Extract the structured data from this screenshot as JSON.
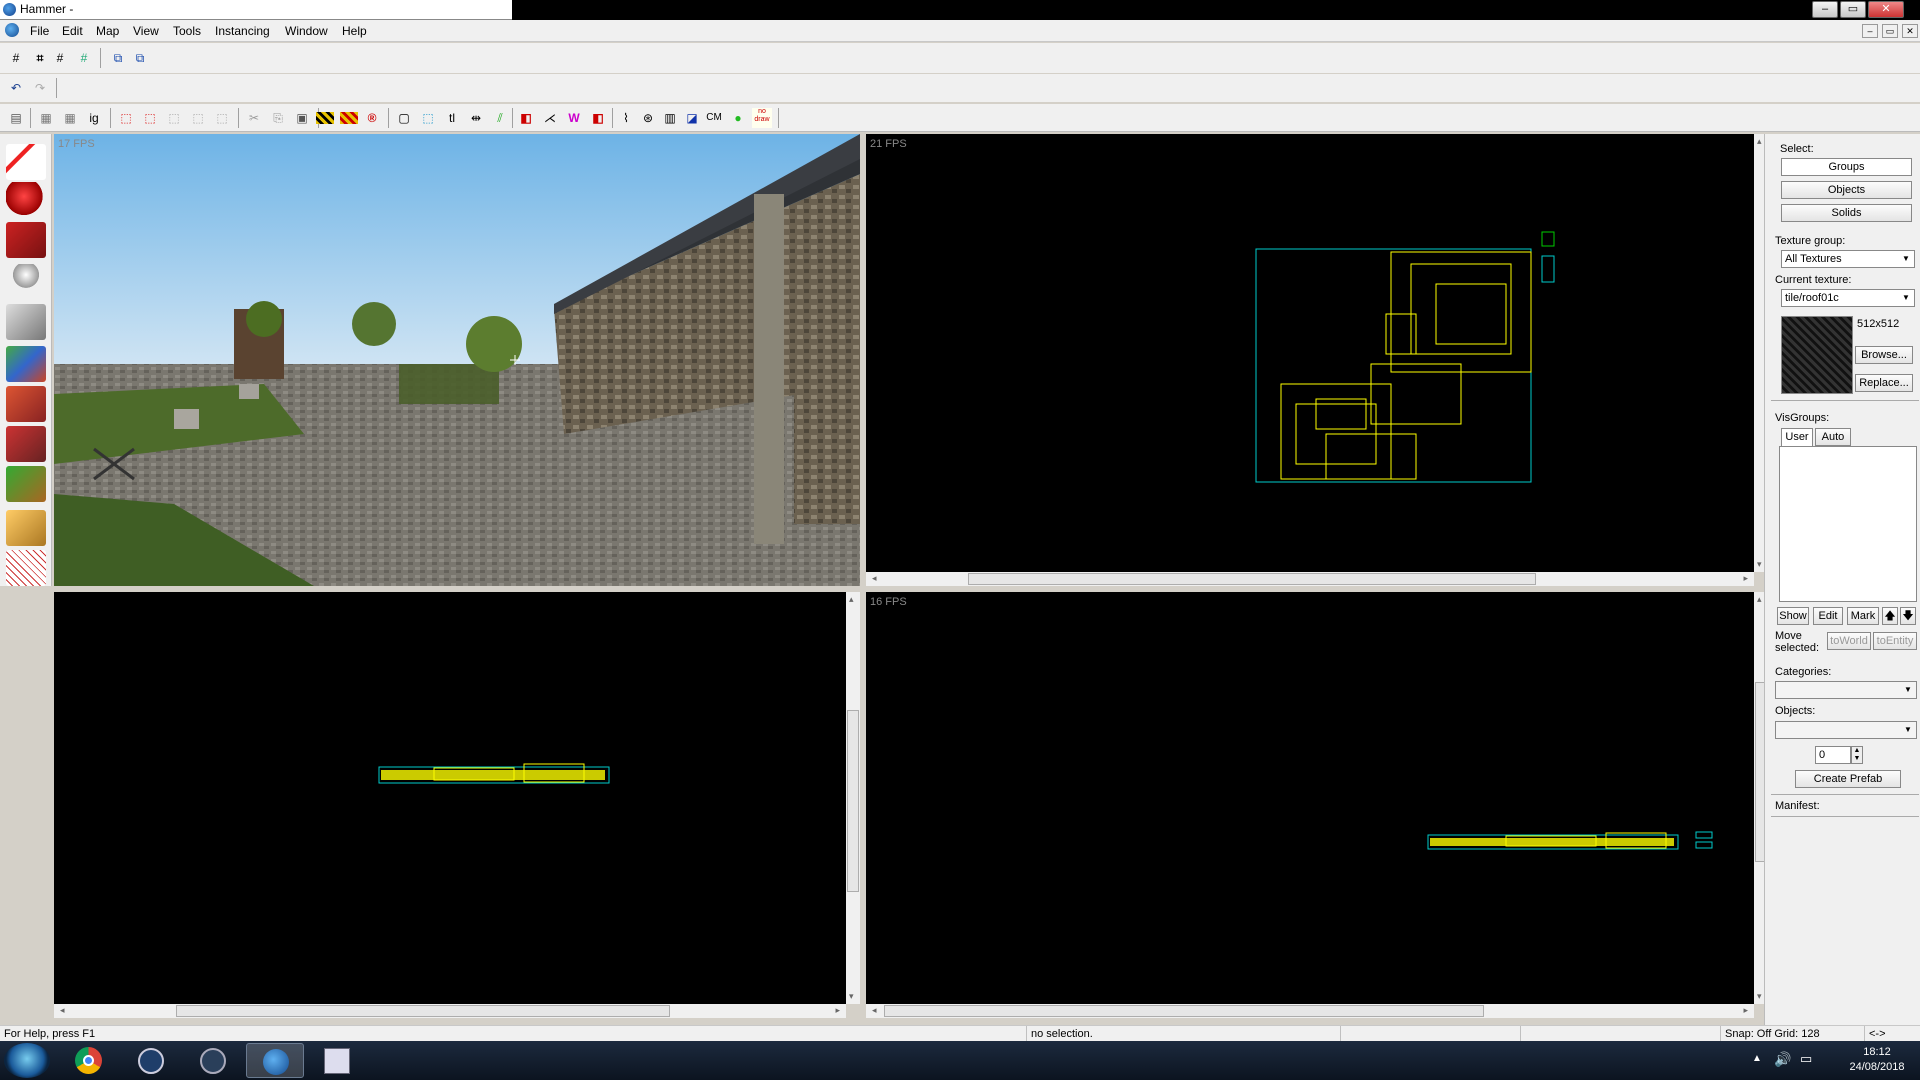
{
  "window": {
    "title": "Hammer -",
    "min": "–",
    "max": "▭",
    "close": "✕"
  },
  "menu": [
    "File",
    "Edit",
    "Map",
    "View",
    "Tools",
    "Instancing",
    "Window",
    "Help"
  ],
  "mdi_controls": [
    "–",
    "▭",
    "✕"
  ],
  "toolbar_text": {
    "ig": "ig",
    "tl": "tl",
    "cm": "CM",
    "nodraw": "no draw"
  },
  "viewports": {
    "camera": {
      "fps": "17 FPS"
    },
    "top": {
      "fps": "21 FPS"
    },
    "side_left": {
      "fps": ""
    },
    "side_right": {
      "fps": "16 FPS"
    }
  },
  "right_panel": {
    "select_label": "Select:",
    "groups": "Groups",
    "objects": "Objects",
    "solids": "Solids",
    "texture_group_label": "Texture group:",
    "texture_group_value": "All Textures",
    "current_texture_label": "Current texture:",
    "current_texture_value": "tile/roof01c",
    "texture_size": "512x512",
    "browse": "Browse...",
    "replace": "Replace...",
    "visgroups_label": "VisGroups:",
    "tab_user": "User",
    "tab_auto": "Auto",
    "show": "Show",
    "edit": "Edit",
    "mark": "Mark",
    "up": "🡅",
    "down": "🡇",
    "move_selected": "Move selected:",
    "to_world": "toWorld",
    "to_entity": "toEntity",
    "categories_label": "Categories:",
    "objects_label": "Objects:",
    "count_value": "0",
    "create_prefab": "Create Prefab",
    "manifest_label": "Manifest:"
  },
  "status": {
    "help": "For Help, press F1",
    "selection": "no selection.",
    "snap": "Snap: Off Grid: 128",
    "extra": "<->"
  },
  "taskbar": {
    "time": "18:12",
    "date": "24/08/2018"
  }
}
